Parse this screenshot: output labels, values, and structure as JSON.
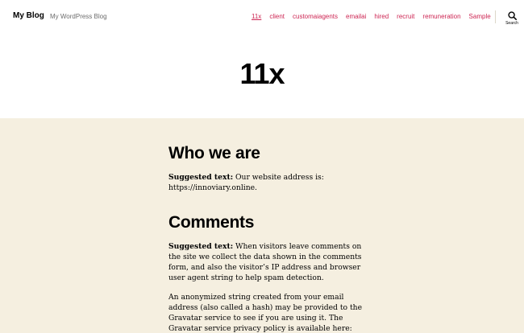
{
  "header": {
    "site_title": "My Blog",
    "site_description": "My WordPress Blog",
    "nav": [
      {
        "label": "11x",
        "current": true
      },
      {
        "label": "client"
      },
      {
        "label": "customaiagents"
      },
      {
        "label": "emailai"
      },
      {
        "label": "hired"
      },
      {
        "label": "recruit"
      },
      {
        "label": "remuneration"
      },
      {
        "label": "Sample"
      }
    ],
    "search_label": "Search",
    "search_icon": "search-icon"
  },
  "page": {
    "title": "11x"
  },
  "content": {
    "who_heading": "Who we are",
    "who_label": "Suggested text:",
    "who_text": " Our website address is: https://innoviary.online.",
    "comments_heading": "Comments",
    "comments_label": "Suggested text:",
    "comments_text": " When visitors leave comments on the site we collect the data shown in the comments form, and also the visitor’s IP address and browser user agent string to help spam detection.",
    "anon_text": "An anonymized string created from your email address (also called a hash) may be provided to the Gravatar service to see if you are using it. The Gravatar service privacy policy is available here:"
  },
  "colors": {
    "accent": "#cd2653",
    "content_background": "#f5efe0",
    "divider": "#dcd7ca"
  }
}
